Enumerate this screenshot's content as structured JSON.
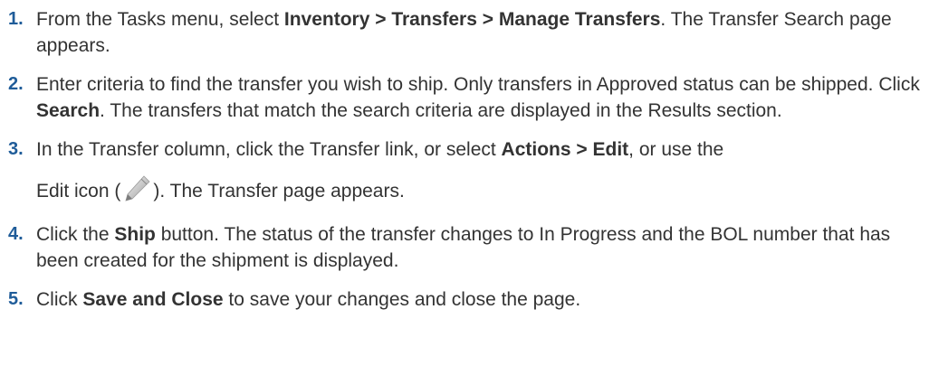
{
  "steps": [
    {
      "num": "1.",
      "t1": "From the Tasks menu, select ",
      "b1": "Inventory > Transfers > Manage Transfers",
      "t2": ". The Transfer Search page appears."
    },
    {
      "num": "2.",
      "t1": "Enter criteria to find the transfer you wish to ship. Only transfers in Approved status can be shipped. Click ",
      "b1": "Search",
      "t2": ". The transfers that match the search criteria are displayed in the Results section."
    },
    {
      "num": "3.",
      "t1": "In the Transfer column, click the Transfer link, or select ",
      "b1": "Actions > Edit",
      "t2": ", or use the",
      "t3": "Edit icon (",
      "icon": "edit-pencil-icon",
      "t4": "). The Transfer page appears."
    },
    {
      "num": "4.",
      "t1": "Click the ",
      "b1": "Ship",
      "t2": " button. The status of the transfer changes to In Progress and the BOL number that has been created for the shipment is displayed."
    },
    {
      "num": "5.",
      "t1": "Click ",
      "b1": "Save and Close",
      "t2": " to save your changes and close the page."
    }
  ],
  "colors": {
    "text": "#333333",
    "step_number": "#1f5c99"
  }
}
